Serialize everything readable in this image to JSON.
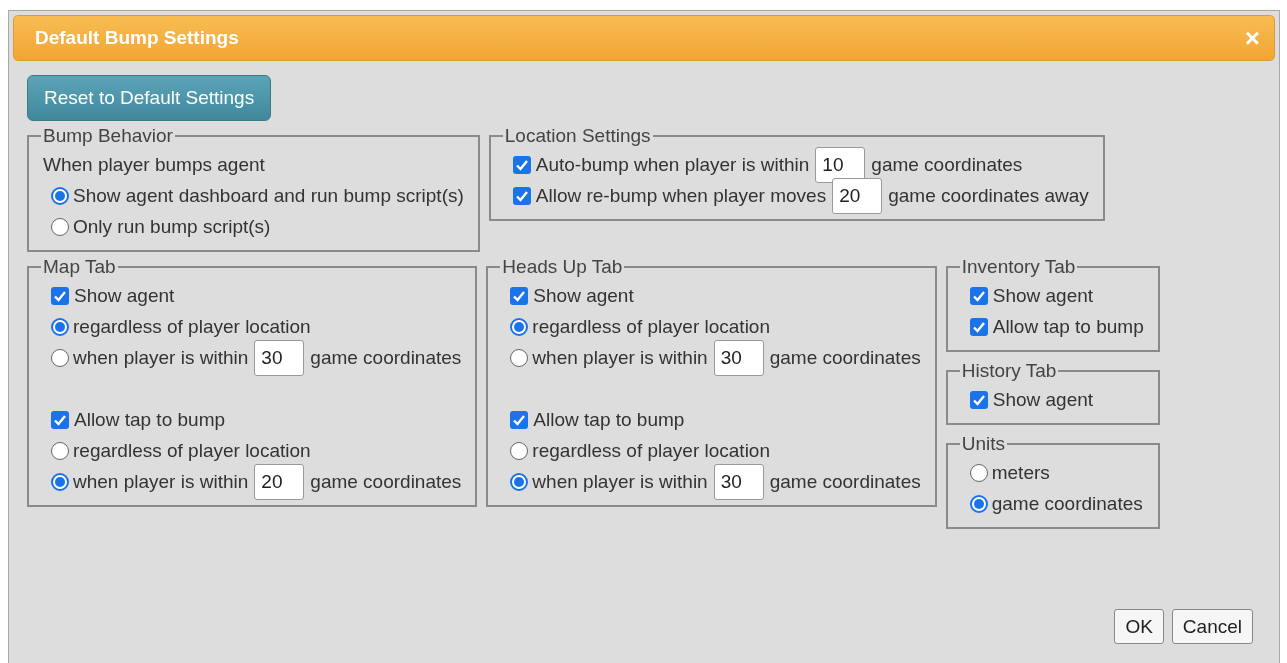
{
  "dialog": {
    "title": "Default Bump Settings",
    "close": "×"
  },
  "reset_button": "Reset to Default Settings",
  "top_row": [
    {
      "title": "Bump Behavior",
      "sections": [
        [
          {
            "kind": "text",
            "text": "When player bumps agent"
          },
          {
            "kind": "radio",
            "label": "Show agent dashboard and run bump script(s)",
            "selected": true
          },
          {
            "kind": "radio",
            "label": "Only run bump script(s)",
            "selected": false
          }
        ]
      ]
    },
    {
      "title": "Location Settings",
      "sections": [
        [
          {
            "kind": "checkbox",
            "label": "Auto-bump when player is within",
            "checked": true,
            "value": "10",
            "suffix": "game coordinates"
          },
          {
            "kind": "checkbox",
            "label": "Allow re-bump when player moves",
            "checked": true,
            "value": "20",
            "suffix": "game coordinates away"
          }
        ]
      ]
    }
  ],
  "bottom_row": [
    {
      "title": "Map Tab",
      "sections": [
        [
          {
            "kind": "checkbox",
            "label": "Show agent",
            "checked": true
          },
          {
            "kind": "radio",
            "label": "regardless of player location",
            "selected": true
          },
          {
            "kind": "radio",
            "label": "when player is within",
            "selected": false,
            "value": "30",
            "suffix": "game coordinates"
          }
        ],
        [
          {
            "kind": "checkbox",
            "label": "Allow tap to bump",
            "checked": true
          },
          {
            "kind": "radio",
            "label": "regardless of player location",
            "selected": false
          },
          {
            "kind": "radio",
            "label": "when player is within",
            "selected": true,
            "value": "20",
            "suffix": "game coordinates"
          }
        ]
      ]
    },
    {
      "title": "Heads Up Tab",
      "sections": [
        [
          {
            "kind": "checkbox",
            "label": "Show agent",
            "checked": true
          },
          {
            "kind": "radio",
            "label": "regardless of player location",
            "selected": true
          },
          {
            "kind": "radio",
            "label": "when player is within",
            "selected": false,
            "value": "30",
            "suffix": "game coordinates"
          }
        ],
        [
          {
            "kind": "checkbox",
            "label": "Allow tap to bump",
            "checked": true
          },
          {
            "kind": "radio",
            "label": "regardless of player location",
            "selected": false
          },
          {
            "kind": "radio",
            "label": "when player is within",
            "selected": true,
            "value": "30",
            "suffix": "game coordinates"
          }
        ]
      ]
    }
  ],
  "side_column": [
    {
      "title": "Inventory Tab",
      "sections": [
        [
          {
            "kind": "checkbox",
            "label": "Show agent",
            "checked": true
          },
          {
            "kind": "checkbox",
            "label": "Allow tap to bump",
            "checked": true
          }
        ]
      ]
    },
    {
      "title": "History Tab",
      "sections": [
        [
          {
            "kind": "checkbox",
            "label": "Show agent",
            "checked": true
          }
        ]
      ]
    },
    {
      "title": "Units",
      "sections": [
        [
          {
            "kind": "radio",
            "label": "meters",
            "selected": false
          },
          {
            "kind": "radio",
            "label": "game coordinates",
            "selected": true
          }
        ]
      ]
    }
  ],
  "footer_buttons": [
    "OK",
    "Cancel"
  ]
}
